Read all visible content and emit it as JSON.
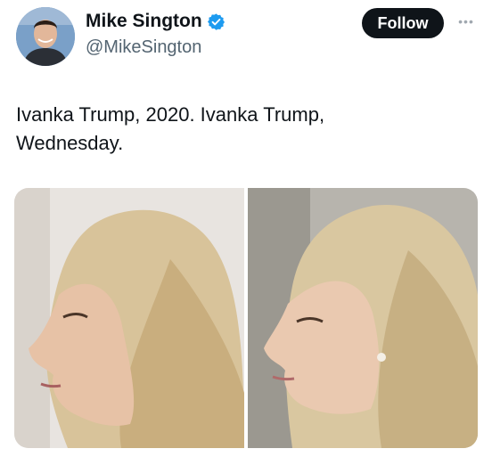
{
  "author": {
    "display_name": "Mike Sington",
    "handle": "@MikeSington",
    "verified": true,
    "avatar_icon": "profile-photo"
  },
  "actions": {
    "follow_label": "Follow",
    "more_icon": "more-horizontal-icon"
  },
  "tweet": {
    "text_line1": "Ivanka Trump, 2020. Ivanka Trump,",
    "text_line2": "Wednesday."
  },
  "colors": {
    "verified_blue": "#1d9bf0",
    "follow_bg": "#0f1419",
    "handle_gray": "#536471"
  }
}
